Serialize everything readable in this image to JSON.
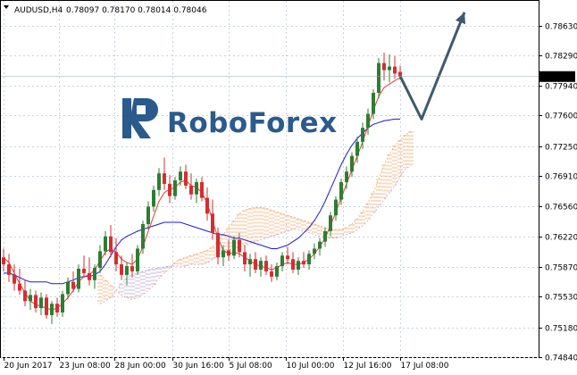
{
  "header": {
    "symbol": "AUDUSD,H4",
    "values": "0.78097 0.78170 0.78014 0.78046"
  },
  "logo": {
    "text": "RoboForex",
    "color": "#2a5b8c"
  },
  "colors": {
    "bull": "#2e7d32",
    "bear": "#d32f2f",
    "tenkan": "#e53935",
    "kijun": "#1a1ad6",
    "cloud_up": "#f0a868",
    "cloud_down": "#b9a4d8",
    "arrow": "#3e5a6e",
    "grid": "#c8d4df"
  },
  "chart_data": {
    "type": "candlestick",
    "symbol": "AUDUSD,H4",
    "ylim": [
      0.7484,
      0.7888
    ],
    "y_ticks": [
      "0.78630",
      "0.78290",
      "0.77940",
      "0.77600",
      "0.77250",
      "0.76910",
      "0.76560",
      "0.76220",
      "0.75870",
      "0.75530",
      "0.75180",
      "0.74840"
    ],
    "current_price": "0.78046",
    "x_ticks": [
      "20 Jun 2017",
      "23 Jun 08:00",
      "28 Jun 00:00",
      "30 Jun 16:00",
      "5 Jul 08:00",
      "10 Jul 00:00",
      "12 Jul 16:00",
      "17 Jul 08:00"
    ],
    "candles": [
      [
        0.7598,
        0.7608,
        0.7582,
        0.759
      ],
      [
        0.759,
        0.7602,
        0.757,
        0.7578
      ],
      [
        0.7578,
        0.759,
        0.756,
        0.7568
      ],
      [
        0.7568,
        0.7585,
        0.7555,
        0.756
      ],
      [
        0.756,
        0.7572,
        0.7542,
        0.7548
      ],
      [
        0.7548,
        0.7562,
        0.7538,
        0.7555
      ],
      [
        0.7555,
        0.756,
        0.7535,
        0.754
      ],
      [
        0.754,
        0.7558,
        0.7532,
        0.7552
      ],
      [
        0.7552,
        0.7556,
        0.7528,
        0.7532
      ],
      [
        0.7532,
        0.7548,
        0.7522,
        0.7545
      ],
      [
        0.7545,
        0.7552,
        0.753,
        0.7535
      ],
      [
        0.7535,
        0.756,
        0.753,
        0.7556
      ],
      [
        0.7556,
        0.7575,
        0.755,
        0.757
      ],
      [
        0.757,
        0.7582,
        0.7558,
        0.7562
      ],
      [
        0.7562,
        0.759,
        0.7558,
        0.7585
      ],
      [
        0.7585,
        0.76,
        0.7575,
        0.758
      ],
      [
        0.758,
        0.7598,
        0.7566,
        0.7572
      ],
      [
        0.7572,
        0.759,
        0.7562,
        0.7586
      ],
      [
        0.7586,
        0.7612,
        0.758,
        0.7605
      ],
      [
        0.7605,
        0.7628,
        0.76,
        0.7622
      ],
      [
        0.7622,
        0.7635,
        0.7598,
        0.7604
      ],
      [
        0.7604,
        0.762,
        0.7582,
        0.759
      ],
      [
        0.759,
        0.76,
        0.7572,
        0.7578
      ],
      [
        0.7578,
        0.7592,
        0.7566,
        0.7588
      ],
      [
        0.7588,
        0.7602,
        0.7575,
        0.7582
      ],
      [
        0.7582,
        0.7612,
        0.7578,
        0.7608
      ],
      [
        0.7608,
        0.764,
        0.7602,
        0.7636
      ],
      [
        0.7636,
        0.7662,
        0.763,
        0.7656
      ],
      [
        0.7656,
        0.768,
        0.765,
        0.7675
      ],
      [
        0.7675,
        0.77,
        0.7668,
        0.7694
      ],
      [
        0.7694,
        0.7712,
        0.7675,
        0.7682
      ],
      [
        0.7682,
        0.7692,
        0.766,
        0.7668
      ],
      [
        0.7668,
        0.769,
        0.7664,
        0.7686
      ],
      [
        0.7686,
        0.7702,
        0.768,
        0.7696
      ],
      [
        0.7696,
        0.7704,
        0.7676,
        0.768
      ],
      [
        0.768,
        0.7694,
        0.7664,
        0.767
      ],
      [
        0.767,
        0.7688,
        0.766,
        0.7684
      ],
      [
        0.7684,
        0.769,
        0.7662,
        0.7666
      ],
      [
        0.7666,
        0.7678,
        0.764,
        0.7648
      ],
      [
        0.7648,
        0.7664,
        0.7618,
        0.7626
      ],
      [
        0.7626,
        0.7632,
        0.759,
        0.7598
      ],
      [
        0.7598,
        0.7612,
        0.7588,
        0.7606
      ],
      [
        0.7606,
        0.7618,
        0.7594,
        0.76
      ],
      [
        0.76,
        0.7622,
        0.7596,
        0.7618
      ],
      [
        0.7618,
        0.7626,
        0.7598,
        0.7604
      ],
      [
        0.7604,
        0.7612,
        0.7582,
        0.759
      ],
      [
        0.759,
        0.7602,
        0.7576,
        0.7596
      ],
      [
        0.7596,
        0.7604,
        0.758,
        0.7584
      ],
      [
        0.7584,
        0.7598,
        0.7576,
        0.7594
      ],
      [
        0.7594,
        0.76,
        0.7578,
        0.7582
      ],
      [
        0.7582,
        0.759,
        0.757,
        0.7576
      ],
      [
        0.7576,
        0.7592,
        0.7572,
        0.7588
      ],
      [
        0.7588,
        0.7604,
        0.7582,
        0.76
      ],
      [
        0.76,
        0.761,
        0.759,
        0.7596
      ],
      [
        0.7596,
        0.7604,
        0.758,
        0.7584
      ],
      [
        0.7584,
        0.7598,
        0.7578,
        0.7594
      ],
      [
        0.7594,
        0.7604,
        0.7586,
        0.759
      ],
      [
        0.759,
        0.7606,
        0.7584,
        0.7602
      ],
      [
        0.7602,
        0.7614,
        0.7596,
        0.7608
      ],
      [
        0.7608,
        0.762,
        0.76,
        0.7616
      ],
      [
        0.7616,
        0.7632,
        0.761,
        0.7628
      ],
      [
        0.7628,
        0.765,
        0.7622,
        0.7646
      ],
      [
        0.7646,
        0.7668,
        0.764,
        0.7664
      ],
      [
        0.7664,
        0.7688,
        0.7658,
        0.7684
      ],
      [
        0.7684,
        0.7702,
        0.7676,
        0.7696
      ],
      [
        0.7696,
        0.7718,
        0.769,
        0.7714
      ],
      [
        0.7714,
        0.7736,
        0.7706,
        0.773
      ],
      [
        0.773,
        0.7752,
        0.7722,
        0.7746
      ],
      [
        0.7746,
        0.7768,
        0.7738,
        0.7762
      ],
      [
        0.7762,
        0.779,
        0.7756,
        0.7786
      ],
      [
        0.7786,
        0.7826,
        0.778,
        0.782
      ],
      [
        0.782,
        0.7832,
        0.78,
        0.7812
      ],
      [
        0.7812,
        0.783,
        0.7798,
        0.7816
      ],
      [
        0.7816,
        0.7828,
        0.7802,
        0.7808
      ],
      [
        0.781,
        0.7817,
        0.7801,
        0.7805
      ]
    ],
    "tenkan": [
      0.7598,
      0.7592,
      0.758,
      0.7568,
      0.7558,
      0.7548,
      0.7544,
      0.7542,
      0.754,
      0.7538,
      0.754,
      0.7545,
      0.7552,
      0.756,
      0.757,
      0.7576,
      0.7578,
      0.7584,
      0.7594,
      0.7604,
      0.7608,
      0.7604,
      0.7596,
      0.7592,
      0.759,
      0.7596,
      0.761,
      0.7628,
      0.7645,
      0.7662,
      0.7672,
      0.7676,
      0.7678,
      0.7684,
      0.7686,
      0.768,
      0.7678,
      0.7672,
      0.766,
      0.764,
      0.762,
      0.7606,
      0.7602,
      0.7604,
      0.7602,
      0.7598,
      0.7594,
      0.759,
      0.7588,
      0.7586,
      0.7584,
      0.7586,
      0.759,
      0.7592,
      0.759,
      0.759,
      0.7592,
      0.7596,
      0.7602,
      0.761,
      0.762,
      0.7634,
      0.765,
      0.7666,
      0.7682,
      0.7698,
      0.7714,
      0.773,
      0.7748,
      0.7766,
      0.7782,
      0.7792,
      0.7796,
      0.78,
      0.7803
    ],
    "kijun": [
      0.758,
      0.758,
      0.7578,
      0.7575,
      0.7572,
      0.757,
      0.757,
      0.757,
      0.757,
      0.7568,
      0.7568,
      0.7568,
      0.757,
      0.7572,
      0.7575,
      0.7576,
      0.7576,
      0.7578,
      0.7582,
      0.759,
      0.76,
      0.761,
      0.7618,
      0.7622,
      0.7625,
      0.7628,
      0.763,
      0.7632,
      0.7634,
      0.7636,
      0.7638,
      0.7638,
      0.7638,
      0.7638,
      0.7636,
      0.7634,
      0.7632,
      0.763,
      0.7628,
      0.7626,
      0.7624,
      0.7624,
      0.7622,
      0.762,
      0.762,
      0.7618,
      0.7616,
      0.7614,
      0.7612,
      0.761,
      0.7608,
      0.7608,
      0.761,
      0.7612,
      0.7616,
      0.762,
      0.7626,
      0.7632,
      0.764,
      0.765,
      0.7662,
      0.7676,
      0.769,
      0.7704,
      0.7716,
      0.7726,
      0.7734,
      0.774,
      0.7746,
      0.775,
      0.7752,
      0.7754,
      0.7755,
      0.7756,
      0.7756
    ],
    "cloud_a": [
      0.7578,
      0.7572,
      0.7566,
      0.756,
      0.7555,
      0.7552,
      0.755,
      0.7552,
      0.7556,
      0.756,
      0.7566,
      0.7574,
      0.758,
      0.7586,
      0.7592,
      0.7596,
      0.7598,
      0.76,
      0.7602,
      0.7604,
      0.7606,
      0.761,
      0.7616,
      0.7624,
      0.7632,
      0.764,
      0.7648,
      0.7652,
      0.7654,
      0.7655,
      0.7655,
      0.7654,
      0.7652,
      0.765,
      0.7648,
      0.7646,
      0.7644,
      0.7642,
      0.764,
      0.7638,
      0.7636,
      0.7634,
      0.7632,
      0.763,
      0.763,
      0.763,
      0.7632,
      0.7636,
      0.7642,
      0.765,
      0.766,
      0.7672,
      0.7688,
      0.7704,
      0.7716,
      0.7726,
      0.7732,
      0.7738,
      0.7742
    ],
    "cloud_b": [
      0.7545,
      0.7548,
      0.7552,
      0.756,
      0.7568,
      0.7574,
      0.7578,
      0.758,
      0.7582,
      0.7584,
      0.7585,
      0.7586,
      0.7587,
      0.7588,
      0.7588,
      0.7588,
      0.7588,
      0.759,
      0.759,
      0.759,
      0.7592,
      0.7596,
      0.76,
      0.7604,
      0.7606,
      0.7608,
      0.761,
      0.7612,
      0.7614,
      0.7616,
      0.7618,
      0.762,
      0.7622,
      0.7624,
      0.7626,
      0.7628,
      0.763,
      0.763,
      0.7628,
      0.7626,
      0.7624,
      0.7622,
      0.762,
      0.762,
      0.762,
      0.7622,
      0.7624,
      0.7626,
      0.763,
      0.7634,
      0.764,
      0.7648,
      0.7656,
      0.7664,
      0.7672,
      0.768,
      0.769,
      0.77,
      0.7702
    ],
    "forecast_path": [
      [
        74,
        0.7805
      ],
      [
        78,
        0.7756
      ],
      [
        86,
        0.7878
      ]
    ],
    "grid": true
  }
}
